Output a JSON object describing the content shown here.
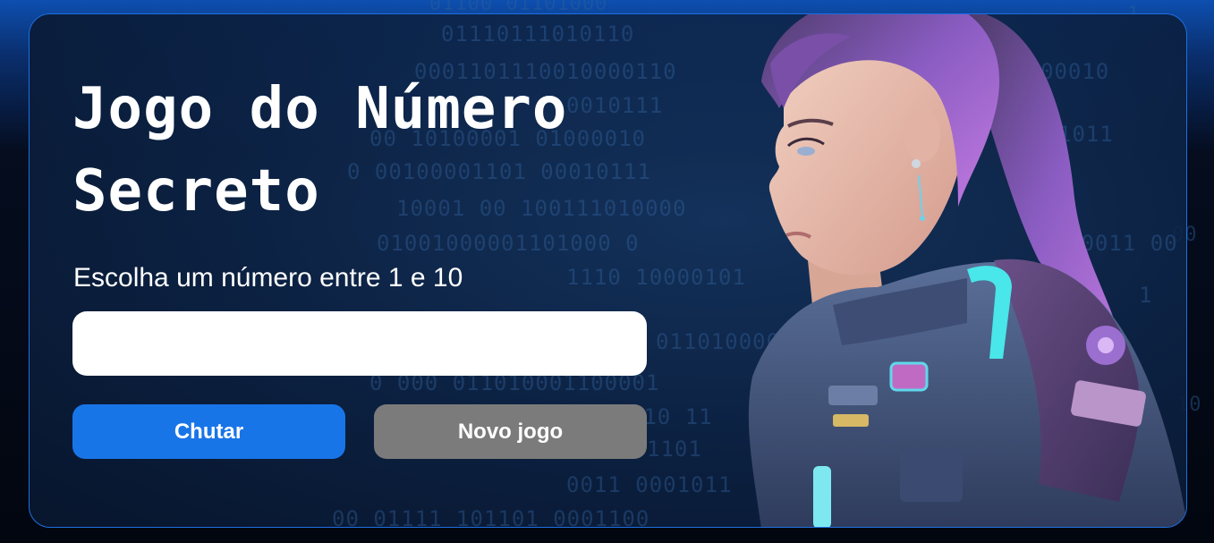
{
  "game": {
    "title": "Jogo do Número Secreto",
    "instruction": "Escolha um número entre 1 e 10",
    "input_value": "",
    "guess_button": "Chutar",
    "new_game_button": "Novo jogo"
  },
  "illustration": {
    "icon": "astronaut-woman-illustration"
  },
  "colors": {
    "accent": "#1875e8",
    "secondary_button": "#7b7b7b",
    "border": "#1e6fe0"
  }
}
